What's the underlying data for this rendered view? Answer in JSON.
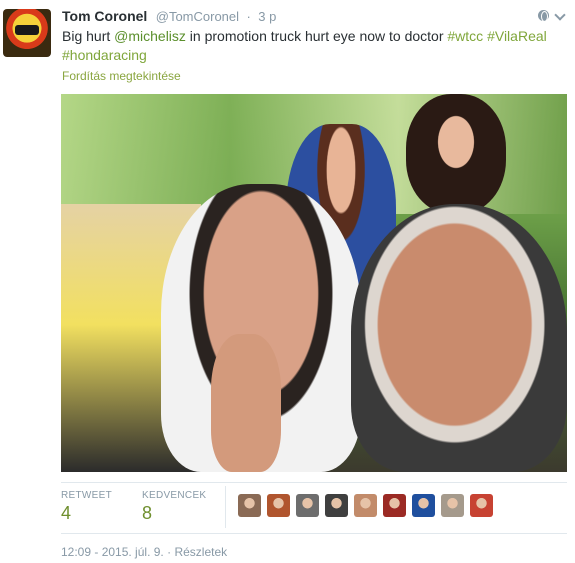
{
  "tweet": {
    "author_name": "Tom Coronel",
    "screen_name": "@TomCoronel",
    "separator": "·",
    "relative_time": "3 p",
    "text_parts": [
      {
        "type": "text",
        "value": "Big hurt "
      },
      {
        "type": "mention",
        "value": "@michelisz"
      },
      {
        "type": "text",
        "value": " in promotion truck hurt eye now to doctor "
      },
      {
        "type": "hashtag",
        "value": "#wtcc"
      },
      {
        "type": "text",
        "value": " "
      },
      {
        "type": "hashtag",
        "value": "#VilaReal"
      },
      {
        "type": "text",
        "value": " "
      },
      {
        "type": "hashtag",
        "value": "#hondaracing"
      }
    ],
    "translate_label": "Fordítás megtekintése"
  },
  "stats": {
    "retweet_label": "RETWEET",
    "retweet_count": "4",
    "favorites_label": "KEDVENCEK",
    "favorites_count": "8"
  },
  "favoriters": [
    {
      "name": "favoriter-1",
      "color": "#8a6a55"
    },
    {
      "name": "favoriter-2",
      "color": "#b0552e"
    },
    {
      "name": "favoriter-3",
      "color": "#6d6d6d"
    },
    {
      "name": "favoriter-4",
      "color": "#3f3f3f"
    },
    {
      "name": "favoriter-5",
      "color": "#c28b6a"
    },
    {
      "name": "favoriter-6",
      "color": "#9b2a24"
    },
    {
      "name": "favoriter-7",
      "color": "#1f4f9e"
    },
    {
      "name": "favoriter-8",
      "color": "#a59a8c"
    },
    {
      "name": "favoriter-9",
      "color": "#c74232"
    }
  ],
  "footer": {
    "timestamp": "12:09 - 2015. júl. 9.",
    "separator": "·",
    "details_link": "Részletek"
  },
  "colors": {
    "link_green": "#7fa63a",
    "meta_gray": "#8899a6"
  }
}
